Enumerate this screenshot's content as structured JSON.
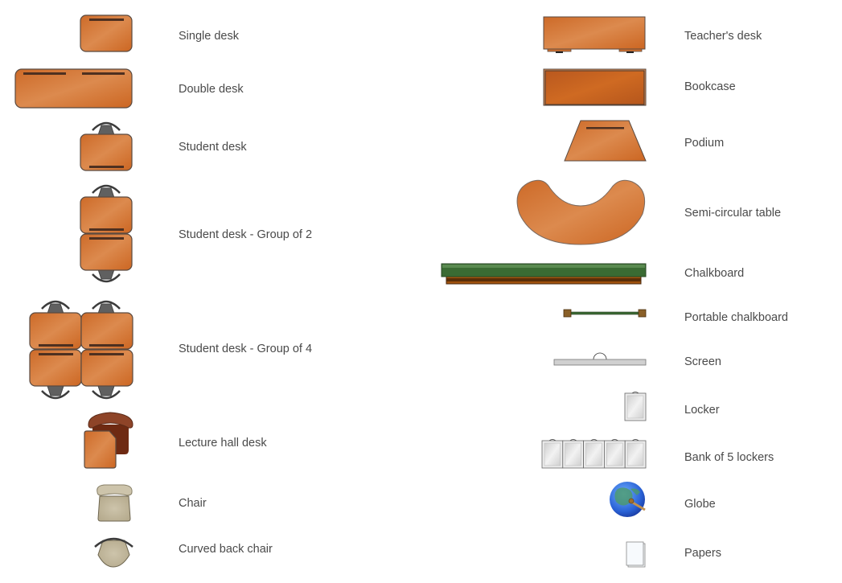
{
  "colors": {
    "wood": "#d2712f",
    "wood_light": "#dc8a4e",
    "outline": "#5a4a40",
    "desk_bar": "#4e3020",
    "chair_dark": "#5f5f5f",
    "lecture_seat": "#6e2a12",
    "beige_chair": "#c2b89e",
    "chalk_green": "#3a6b33",
    "chalk_ledge": "#8a4a10",
    "locker_gray": "#d9d9d9",
    "globe_blue": "#2d6fd8"
  },
  "left_column": [
    {
      "label": "Single desk",
      "icon": "single-desk-icon"
    },
    {
      "label": "Double desk",
      "icon": "double-desk-icon"
    },
    {
      "label": "Student desk",
      "icon": "student-desk-icon"
    },
    {
      "label": "Student desk - Group of 2",
      "icon": "student-desk-group-2-icon"
    },
    {
      "label": "Student desk - Group of 4",
      "icon": "student-desk-group-4-icon"
    },
    {
      "label": "Lecture hall desk",
      "icon": "lecture-hall-desk-icon"
    },
    {
      "label": "Chair",
      "icon": "chair-icon"
    },
    {
      "label": "Curved back chair",
      "icon": "curved-back-chair-icon"
    }
  ],
  "right_column": [
    {
      "label": "Teacher's desk",
      "icon": "teachers-desk-icon"
    },
    {
      "label": "Bookcase",
      "icon": "bookcase-icon"
    },
    {
      "label": "Podium",
      "icon": "podium-icon"
    },
    {
      "label": "Semi-circular table",
      "icon": "semi-circular-table-icon"
    },
    {
      "label": "Chalkboard",
      "icon": "chalkboard-icon"
    },
    {
      "label": "Portable chalkboard",
      "icon": "portable-chalkboard-icon"
    },
    {
      "label": "Screen",
      "icon": "screen-icon"
    },
    {
      "label": "Locker",
      "icon": "locker-icon"
    },
    {
      "label": "Bank of 5 lockers",
      "icon": "bank-of-lockers-icon"
    },
    {
      "label": "Globe",
      "icon": "globe-icon"
    },
    {
      "label": "Papers",
      "icon": "papers-icon"
    }
  ]
}
